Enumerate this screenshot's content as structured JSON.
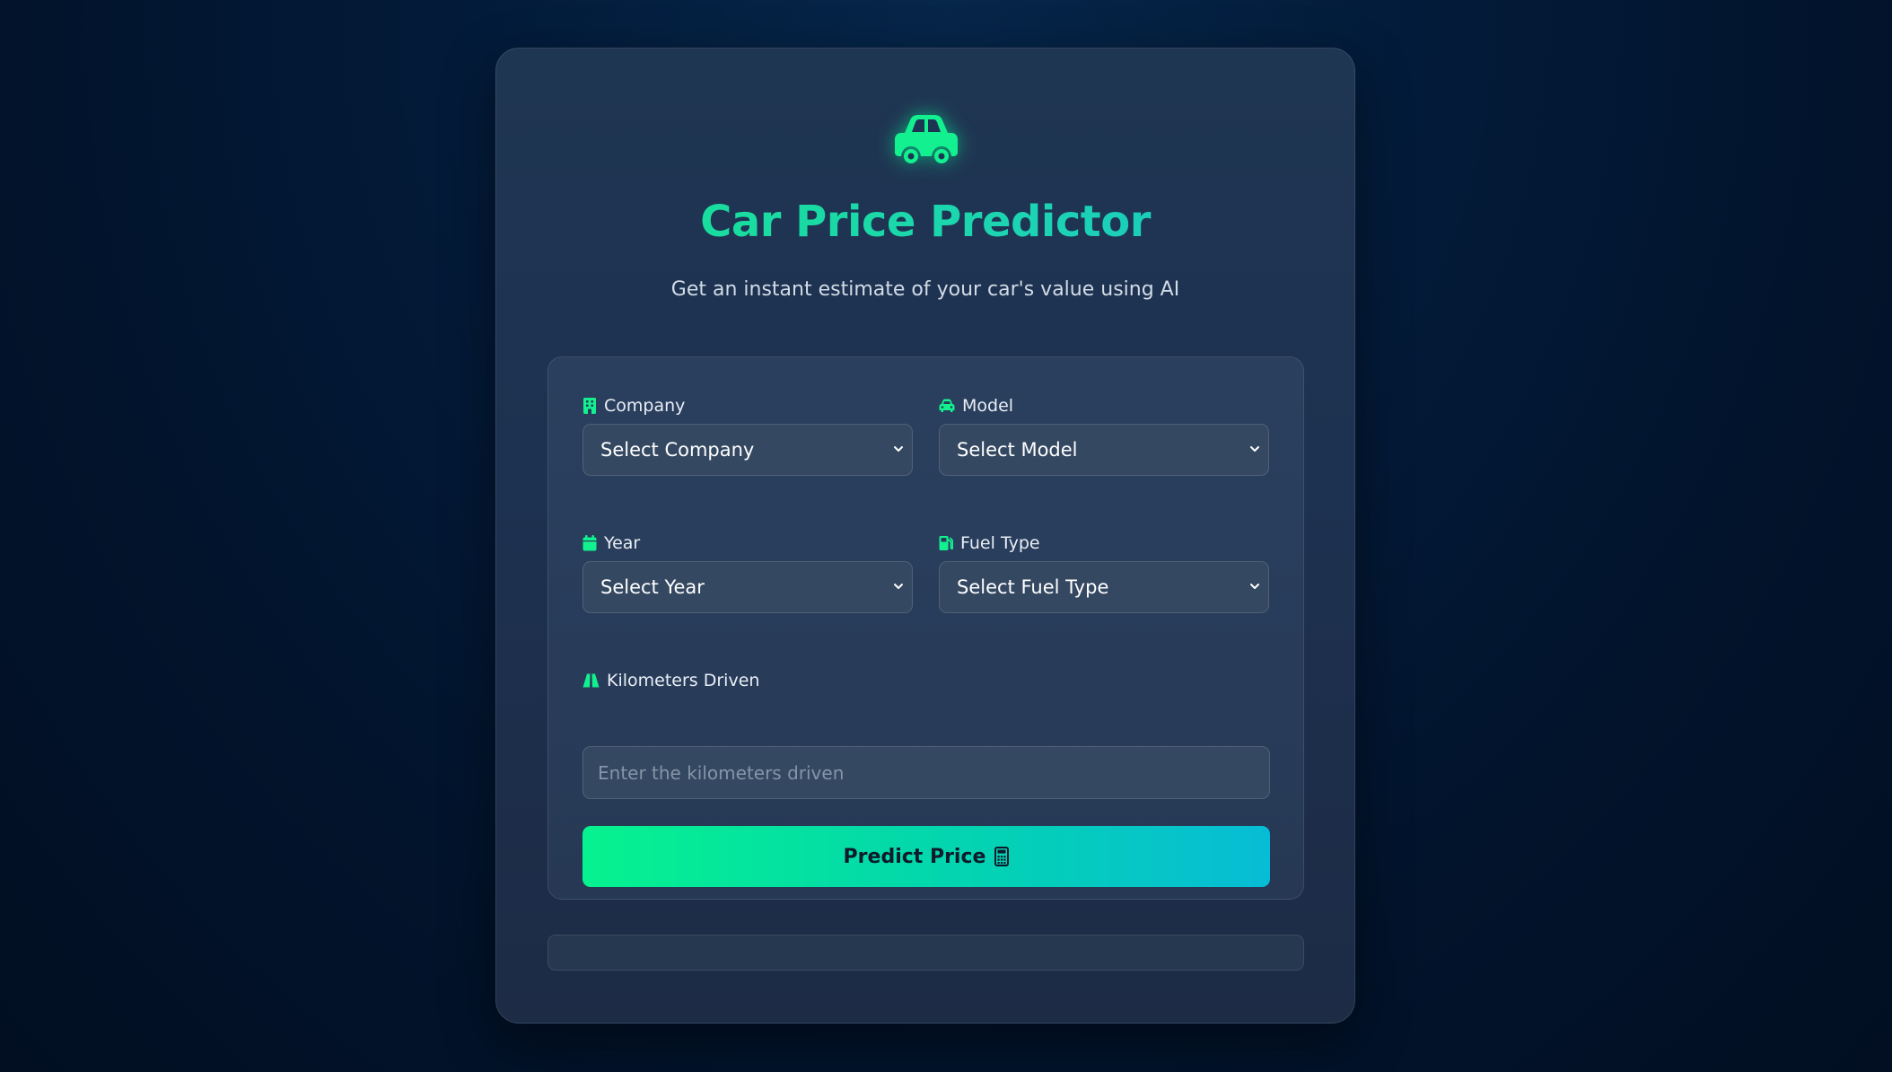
{
  "app": {
    "title": "Car Price Predictor",
    "subtitle": "Get an instant estimate of your car's value using AI",
    "accent_color": "#00f08c",
    "accent_gradient_end": "#06bcd8"
  },
  "form": {
    "company": {
      "label": "Company",
      "icon": "building-icon",
      "selected": "Select Company"
    },
    "model": {
      "label": "Model",
      "icon": "car-icon",
      "selected": "Select Model"
    },
    "year": {
      "label": "Year",
      "icon": "calendar-icon",
      "selected": "Select Year"
    },
    "fuel_type": {
      "label": "Fuel Type",
      "icon": "gas-pump-icon",
      "selected": "Select Fuel Type"
    },
    "kilometers": {
      "label": "Kilometers Driven",
      "icon": "road-icon",
      "placeholder": "Enter the kilometers driven"
    },
    "submit": {
      "label": "Predict Price",
      "icon": "calculator-icon"
    }
  },
  "result": {
    "text": ""
  }
}
